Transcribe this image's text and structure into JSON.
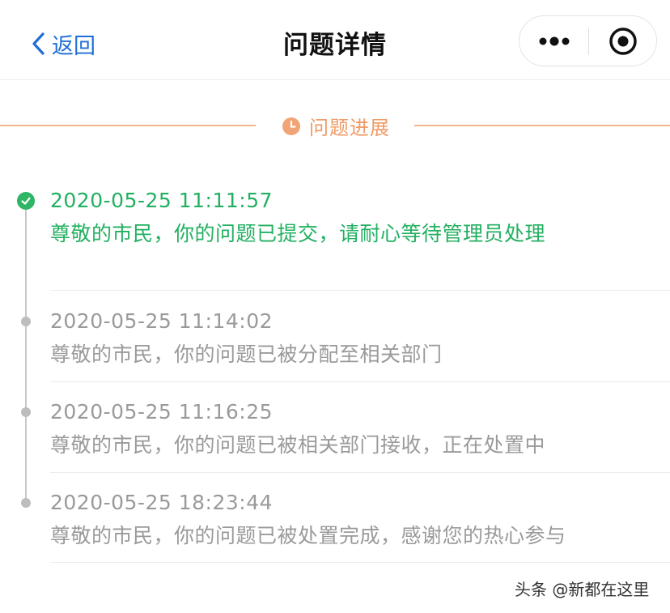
{
  "navbar": {
    "back_label": "返回",
    "title": "问题详情"
  },
  "section": {
    "label": "问题进展"
  },
  "timeline": [
    {
      "time": "2020-05-25 11:11:57",
      "message": "尊敬的市民，你的问题已提交，请耐心等待管理员处理",
      "status": "done"
    },
    {
      "time": "2020-05-25 11:14:02",
      "message": "尊敬的市民，你的问题已被分配至相关部门",
      "status": "pending"
    },
    {
      "time": "2020-05-25 11:16:25",
      "message": "尊敬的市民，你的问题已被相关部门接收，正在处置中",
      "status": "pending"
    },
    {
      "time": "2020-05-25 18:23:44",
      "message": "尊敬的市民，你的问题已被处置完成，感谢您的热心参与",
      "status": "pending"
    }
  ],
  "watermark": "头条 @新都在这里",
  "colors": {
    "accent_blue": "#1f6fd6",
    "success_green": "#23b061",
    "section_orange": "#ef9b66",
    "muted_gray": "#9a9a9a"
  },
  "icons": {
    "back": "chevron-left-icon",
    "more": "more-dots-icon",
    "close": "target-circle-icon",
    "section": "clock-icon",
    "done": "check-icon"
  }
}
